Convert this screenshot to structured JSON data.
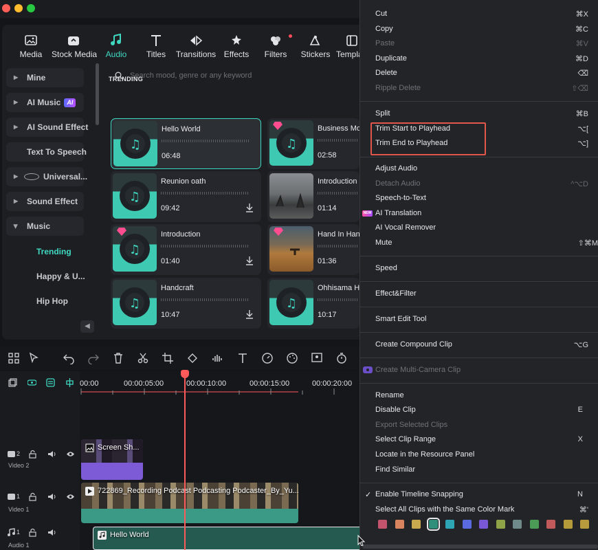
{
  "toolbar": {
    "tabs": [
      {
        "label": "Media",
        "icon": "media-icon"
      },
      {
        "label": "Stock Media",
        "icon": "stock-media-icon"
      },
      {
        "label": "Audio",
        "icon": "audio-note-icon",
        "active": true
      },
      {
        "label": "Titles",
        "icon": "titles-icon"
      },
      {
        "label": "Transitions",
        "icon": "transitions-icon"
      },
      {
        "label": "Effects",
        "icon": "effects-icon"
      },
      {
        "label": "Filters",
        "icon": "filters-icon"
      },
      {
        "label": "Stickers",
        "icon": "stickers-icon"
      },
      {
        "label": "Templa",
        "icon": "templates-icon"
      }
    ]
  },
  "sidebar": {
    "items": [
      {
        "label": "Mine"
      },
      {
        "label": "AI Music",
        "badge": "AI"
      },
      {
        "label": "AI Sound Effect"
      },
      {
        "label": "Text To Speech"
      },
      {
        "label": "Universal..."
      },
      {
        "label": "Sound Effect"
      },
      {
        "label": "Music"
      }
    ],
    "subitems": [
      {
        "label": "Trending",
        "active": true
      },
      {
        "label": "Happy & U..."
      },
      {
        "label": "Hip Hop"
      }
    ]
  },
  "search": {
    "placeholder": "Search mood, genre or any keyword"
  },
  "section_title": "TRENDING",
  "cards": [
    {
      "title": "Hello World",
      "duration": "06:48",
      "selected": true
    },
    {
      "title": "Business Mo",
      "duration": "02:58",
      "premium": true
    },
    {
      "title": "Reunion oath",
      "duration": "09:42"
    },
    {
      "title": "Introduction C",
      "duration": "01:14"
    },
    {
      "title": "Introduction",
      "duration": "01:40",
      "premium": true
    },
    {
      "title": "Hand In Hand",
      "duration": "01:36",
      "premium": true
    },
    {
      "title": "Handcraft",
      "duration": "10:47"
    },
    {
      "title": "Ohhisama Hi",
      "duration": "10:17"
    }
  ],
  "timeline": {
    "ruler": [
      "00:00",
      "00:00:05:00",
      "00:00:10:00",
      "00:00:15:00",
      "00:00:20:00"
    ],
    "tracks": [
      {
        "num": "2",
        "name": "Video 2"
      },
      {
        "num": "1",
        "name": "Video 1"
      },
      {
        "num": "1",
        "name": "Audio 1"
      }
    ],
    "clips": {
      "video2": "Screen Sh...",
      "video1": "722869_Recording Podcast Podcasting Podcaster_By_Yu...",
      "audio1": "Hello World"
    }
  },
  "menu": {
    "items": [
      {
        "label": "Cut",
        "shortcut": "⌘X"
      },
      {
        "label": "Copy",
        "shortcut": "⌘C"
      },
      {
        "label": "Paste",
        "shortcut": "⌘V",
        "disabled": true
      },
      {
        "label": "Duplicate",
        "shortcut": "⌘D"
      },
      {
        "label": "Delete",
        "shortcut": "⌫"
      },
      {
        "label": "Ripple Delete",
        "shortcut": "⇧⌫",
        "disabled": true
      },
      {
        "label": "Split",
        "shortcut": "⌘B"
      },
      {
        "label": "Trim Start to Playhead",
        "shortcut": "⌥["
      },
      {
        "label": "Trim End to Playhead",
        "shortcut": "⌥]"
      },
      {
        "label": "Adjust Audio",
        "shortcut": ""
      },
      {
        "label": "Detach Audio",
        "shortcut": "^⌥D",
        "disabled": true
      },
      {
        "label": "Speech-to-Text",
        "shortcut": ""
      },
      {
        "label": "AI Translation",
        "shortcut": "",
        "tag": "NEW"
      },
      {
        "label": "AI Vocal Remover",
        "shortcut": ""
      },
      {
        "label": "Mute",
        "shortcut": "⇧⌘M"
      },
      {
        "label": "Speed",
        "shortcut": ""
      },
      {
        "label": "Effect&Filter",
        "shortcut": ""
      },
      {
        "label": "Smart Edit Tool",
        "shortcut": ""
      },
      {
        "label": "Create Compound Clip",
        "shortcut": "⌥G"
      },
      {
        "label": "Create Multi-Camera Clip",
        "shortcut": "",
        "disabled": true
      },
      {
        "label": "Rename",
        "shortcut": ""
      },
      {
        "label": "Disable Clip",
        "shortcut": "E"
      },
      {
        "label": "Export Selected Clips",
        "shortcut": "",
        "disabled": true
      },
      {
        "label": "Select Clip Range",
        "shortcut": "X"
      },
      {
        "label": "Locate in the Resource Panel",
        "shortcut": ""
      },
      {
        "label": "Find Similar",
        "shortcut": ""
      },
      {
        "label": "Enable Timeline Snapping",
        "shortcut": "N",
        "checked": true
      },
      {
        "label": "Select All Clips with the Same Color Mark",
        "shortcut": "⌘'"
      }
    ],
    "color_marks": [
      "#c4546e",
      "#d9845e",
      "#c9a94d",
      "#2f8f7a",
      "#2ea5b5",
      "#5a6be0",
      "#7a59d6",
      "#8ea347",
      "#6f8a8a",
      "#4b9a55",
      "#c15a5a",
      "#b59a3a",
      "#b89b3c"
    ]
  }
}
